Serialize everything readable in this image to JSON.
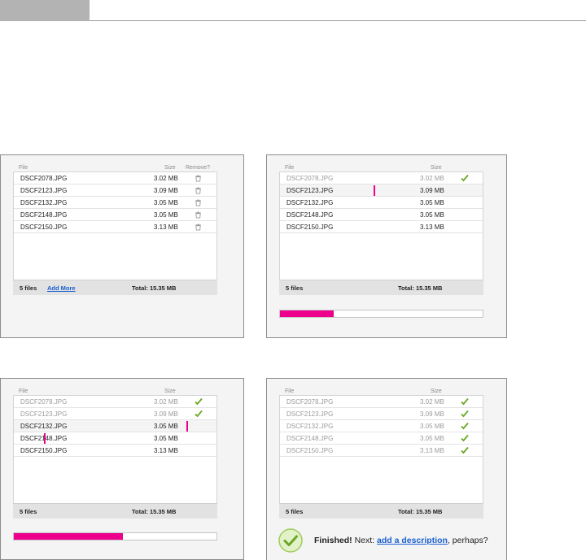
{
  "headers": {
    "file": "File",
    "size": "Size",
    "remove": "Remove?"
  },
  "files": [
    {
      "name": "DSCF2078.JPG",
      "size": "3.02 MB"
    },
    {
      "name": "DSCF2123.JPG",
      "size": "3.09 MB"
    },
    {
      "name": "DSCF2132.JPG",
      "size": "3.05 MB"
    },
    {
      "name": "DSCF2148.JPG",
      "size": "3.05 MB"
    },
    {
      "name": "DSCF2150.JPG",
      "size": "3.13 MB"
    }
  ],
  "footer": {
    "count": "5 files",
    "add_more": "Add More",
    "total": "Total: 15.35 MB"
  },
  "progress": {
    "panel2": 0.265,
    "panel3": 0.54
  },
  "finished": {
    "label": "Finished!",
    "next": "Next:",
    "link": "add a description",
    "suffix": ", perhaps?"
  },
  "colors": {
    "accent": "#ec008c",
    "link": "#1a5fd0",
    "check": "#6aa823"
  }
}
